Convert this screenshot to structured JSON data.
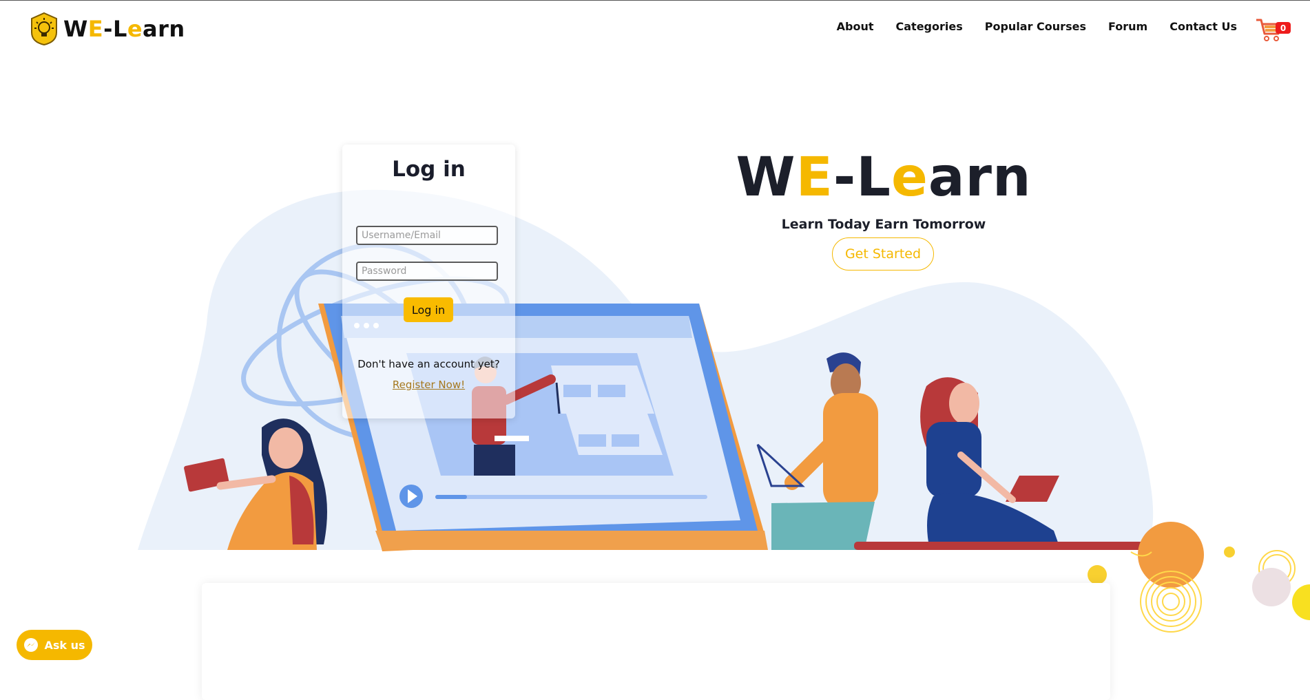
{
  "brand": {
    "logo_prefix_1": "W",
    "logo_prefix_2": "E",
    "logo_dash": "-L",
    "logo_e": "e",
    "logo_rest": "arn"
  },
  "nav": {
    "items": [
      "About",
      "Categories",
      "Popular Courses",
      "Forum",
      "Contact Us"
    ]
  },
  "cart": {
    "count": "0"
  },
  "login": {
    "title": "Log in",
    "username_placeholder": "Username/Email",
    "password_placeholder": "Password",
    "button_label": "Log in",
    "no_account_text": "Don't have an account yet?",
    "register_link": "Register Now!"
  },
  "hero": {
    "title_w": "W",
    "title_e1": "E",
    "title_dash_l": "-L",
    "title_e2": "e",
    "title_rest": "arn",
    "tagline": "Learn Today Earn Tomorrow",
    "cta_label": "Get Started"
  },
  "chat": {
    "label": "Ask us"
  },
  "colors": {
    "accent": "#f5b800",
    "text": "#1c1f2a",
    "badge": "#ee1c1c",
    "blob": "#eaf1fa"
  }
}
